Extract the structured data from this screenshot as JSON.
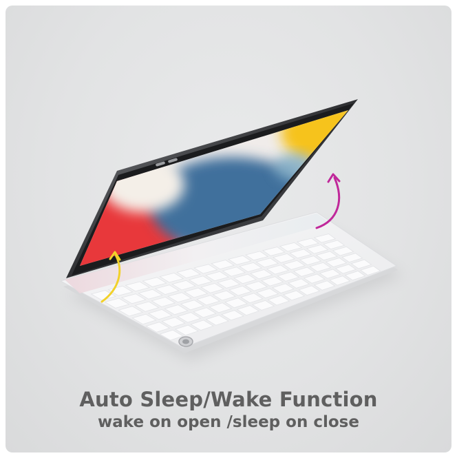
{
  "headline": "Auto Sleep/Wake Function",
  "subline": "wake on open /sleep on close",
  "colors": {
    "background": "#e3e4e5",
    "text": "#5f5f5f",
    "tablet_frame": "#3a3b3d",
    "keyboard": "#f4f4f5",
    "arrow_open": "#f2d12a",
    "arrow_close": "#c0289a",
    "wallpaper_red": "#e8383a",
    "wallpaper_blue": "#3f6f9c",
    "wallpaper_yellow": "#f6c31c"
  },
  "icons": {
    "open_arrow": "curved-arrow-up-icon",
    "close_arrow": "curved-arrow-up-icon",
    "trackpad_button": "round-button-icon"
  }
}
